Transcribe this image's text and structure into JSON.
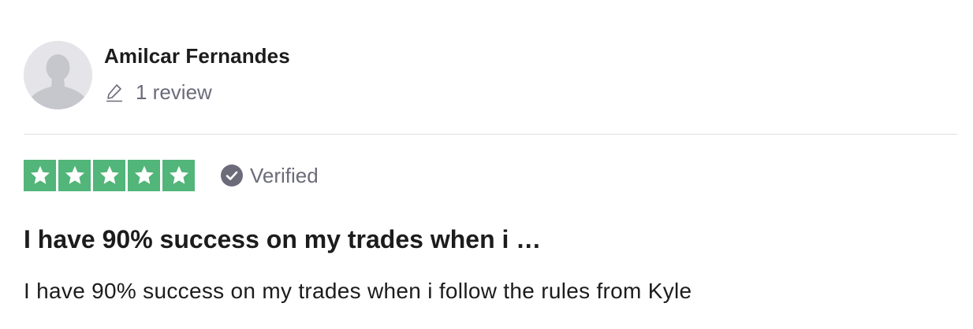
{
  "review": {
    "consumer": {
      "name": "Amilcar Fernandes",
      "avatar_icon": "default-user-silhouette-icon",
      "review_count_icon": "pencil-icon",
      "review_count_label": "1 review"
    },
    "rating": {
      "stars": 5,
      "max_stars": 5,
      "star_color": "#52b579"
    },
    "verified": {
      "icon": "checkmark-circle-icon",
      "label": "Verified"
    },
    "title": "I have 90% success on my trades when i …",
    "body": "I have 90% success on my trades when i follow the rules from Kyle"
  },
  "colors": {
    "text_primary": "#1c1c1c",
    "text_secondary": "#6b6b7a",
    "divider": "#e0e0e6",
    "avatar_bg": "#e5e5e9",
    "star_bg": "#52b579"
  }
}
